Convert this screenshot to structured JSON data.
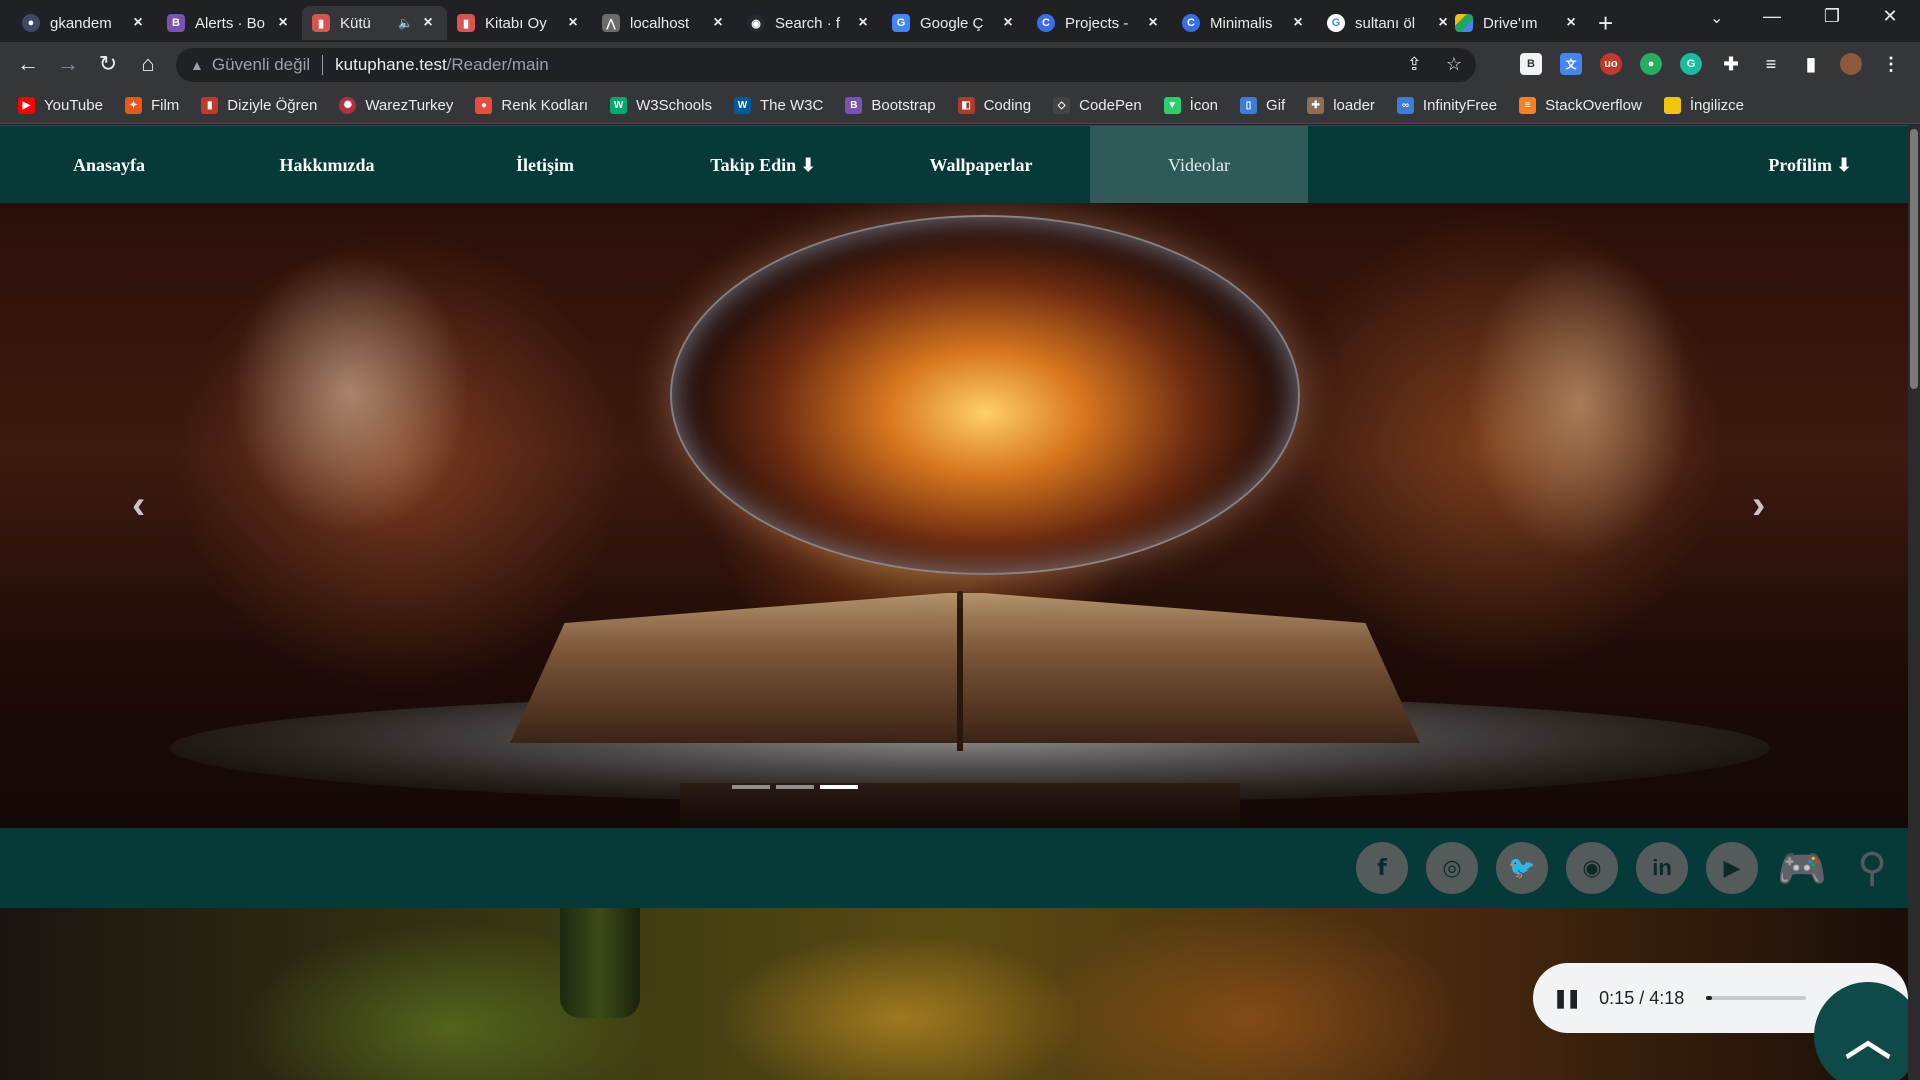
{
  "browser": {
    "tabs": [
      {
        "title": "gkandem",
        "icon": "github-avatar-icon",
        "color": "#3c4a6a"
      },
      {
        "title": "Alerts · Bo",
        "icon": "bootstrap-icon",
        "color": "#7952b3"
      },
      {
        "title": "Kütü",
        "icon": "book-icon",
        "color": "#d9534f",
        "active": true,
        "audio": "🔈"
      },
      {
        "title": "Kitabı Oy",
        "icon": "book-icon",
        "color": "#d9534f"
      },
      {
        "title": "localhost",
        "icon": "laravel-icon",
        "color": "#6b6b6b"
      },
      {
        "title": "Search · f",
        "icon": "github-icon",
        "color": "#24292e"
      },
      {
        "title": "Google Ç",
        "icon": "translate-icon",
        "color": "#4285f4"
      },
      {
        "title": "Projects -",
        "icon": "codepen-c-icon",
        "color": "#3a6ee8"
      },
      {
        "title": "Minimalis",
        "icon": "codepen-c-icon",
        "color": "#3a6ee8"
      },
      {
        "title": "sultanı öl",
        "icon": "google-icon",
        "color": "#ffffff"
      },
      {
        "title": "Drive'ım",
        "icon": "drive-icon",
        "color": "#1fa463"
      }
    ],
    "address": {
      "security_label": "Güvenli değil",
      "host": "kutuphane.test",
      "path": "/Reader/main"
    },
    "bookmarks": [
      {
        "label": "YouTube",
        "color": "#ff0000",
        "icon": "youtube-icon"
      },
      {
        "label": "Film",
        "color": "#e8571c",
        "icon": "film-icon"
      },
      {
        "label": "Diziyle Öğren",
        "color": "#c0392b",
        "icon": "popcorn-icon"
      },
      {
        "label": "WarezTurkey",
        "color": "#b0323f",
        "icon": "warez-icon"
      },
      {
        "label": "Renk Kodları",
        "color": "#e74c3c",
        "icon": "color-icon"
      },
      {
        "label": "W3Schools",
        "color": "#04aa6d",
        "icon": "w3schools-icon"
      },
      {
        "label": "The W3C",
        "color": "#005a9c",
        "icon": "w3c-icon"
      },
      {
        "label": "Bootstrap",
        "color": "#7952b3",
        "icon": "bootstrap-icon"
      },
      {
        "label": "Coding",
        "color": "#b03a2e",
        "icon": "coding-icon"
      },
      {
        "label": "CodePen",
        "color": "#444444",
        "icon": "codepen-icon"
      },
      {
        "label": "İcon",
        "color": "#2ecc71",
        "icon": "icon-site-icon"
      },
      {
        "label": "Gif",
        "color": "#3d7dd8",
        "icon": "gif-icon"
      },
      {
        "label": "loader",
        "color": "#8e6e57",
        "icon": "loader-icon"
      },
      {
        "label": "InfinityFree",
        "color": "#3d7dd8",
        "icon": "infinity-icon"
      },
      {
        "label": "StackOverflow",
        "color": "#f48024",
        "icon": "stackoverflow-icon"
      },
      {
        "label": "İngilizce",
        "color": "#f1c40f",
        "icon": "folder-icon"
      }
    ]
  },
  "navbar": {
    "items": [
      {
        "label": "Anasayfa"
      },
      {
        "label": "Hakkımızda"
      },
      {
        "label": "İletişim"
      },
      {
        "label": "Takip Edin ⬇"
      },
      {
        "label": "Wallpaperlar"
      },
      {
        "label": "Videolar",
        "active": true
      }
    ],
    "profile_label": "Profilim ⬇"
  },
  "carousel": {
    "prev_glyph": "‹",
    "next_glyph": "›",
    "slide_count": 3,
    "active_slide": 3
  },
  "social": {
    "icons": [
      "facebook-icon",
      "instagram-icon",
      "twitter-icon",
      "github-icon",
      "linkedin-icon",
      "youtube-icon",
      "gamepad-icon",
      "search-icon"
    ]
  },
  "audio_player": {
    "time": "0:15 / 4:18",
    "progress": 0.06
  },
  "colors": {
    "navbar_bg": "#063a38",
    "nav_active_bg": "#2e5a58",
    "social_icon": "#555b5a"
  }
}
